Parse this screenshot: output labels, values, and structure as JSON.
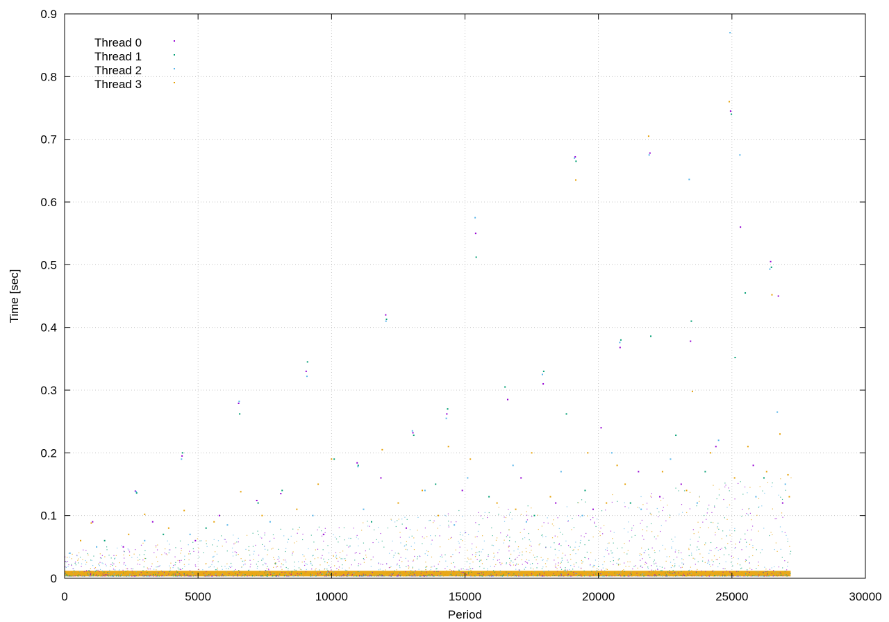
{
  "chart_data": {
    "type": "scatter",
    "xlabel": "Period",
    "ylabel": "Time [sec]",
    "xlim": [
      0,
      30000
    ],
    "ylim": [
      0,
      0.9
    ],
    "xticks": [
      0,
      5000,
      10000,
      15000,
      20000,
      25000,
      30000
    ],
    "yticks": [
      0,
      0.1,
      0.2,
      0.3,
      0.4,
      0.5,
      0.6,
      0.7,
      0.8,
      0.9
    ],
    "xtick_labels": [
      "0",
      "5000",
      "10000",
      "15000",
      "20000",
      "25000",
      "30000"
    ],
    "ytick_labels": [
      "0",
      "0.1",
      "0.2",
      "0.3",
      "0.4",
      "0.5",
      "0.6",
      "0.7",
      "0.8",
      "0.9"
    ],
    "grid": true,
    "legend": "top-left",
    "series": [
      {
        "name": "Thread 0",
        "color": "#9400d3",
        "points": [
          [
            2650,
            0.139
          ],
          [
            4400,
            0.195
          ],
          [
            6520,
            0.279
          ],
          [
            9050,
            0.33
          ],
          [
            10960,
            0.184
          ],
          [
            12030,
            0.42
          ],
          [
            13050,
            0.232
          ],
          [
            14320,
            0.262
          ],
          [
            15400,
            0.55
          ],
          [
            17930,
            0.31
          ],
          [
            19130,
            0.672
          ],
          [
            20810,
            0.368
          ],
          [
            21930,
            0.678
          ],
          [
            23450,
            0.378
          ],
          [
            24950,
            0.745
          ],
          [
            25320,
            0.56
          ],
          [
            26450,
            0.505
          ],
          [
            26740,
            0.45
          ],
          [
            24400,
            0.21
          ],
          [
            22300,
            0.13
          ],
          [
            21500,
            0.17
          ],
          [
            20100,
            0.24
          ],
          [
            18400,
            0.12
          ],
          [
            16600,
            0.285
          ],
          [
            8100,
            0.135
          ],
          [
            7200,
            0.124
          ],
          [
            11850,
            0.16
          ],
          [
            3300,
            0.09
          ],
          [
            1050,
            0.09
          ],
          [
            5800,
            0.1
          ],
          [
            14900,
            0.14
          ],
          [
            17100,
            0.16
          ],
          [
            19800,
            0.11
          ],
          [
            23100,
            0.15
          ],
          [
            25800,
            0.18
          ],
          [
            26900,
            0.12
          ],
          [
            12800,
            0.08
          ],
          [
            9700,
            0.07
          ],
          [
            4900,
            0.06
          ],
          [
            2200,
            0.05
          ]
        ]
      },
      {
        "name": "Thread 1",
        "color": "#009e73",
        "points": [
          [
            2700,
            0.136
          ],
          [
            4420,
            0.2
          ],
          [
            6560,
            0.262
          ],
          [
            9100,
            0.345
          ],
          [
            11000,
            0.18
          ],
          [
            12060,
            0.413
          ],
          [
            13080,
            0.228
          ],
          [
            14350,
            0.27
          ],
          [
            15420,
            0.512
          ],
          [
            17950,
            0.33
          ],
          [
            19160,
            0.665
          ],
          [
            20840,
            0.38
          ],
          [
            21960,
            0.386
          ],
          [
            23480,
            0.41
          ],
          [
            24980,
            0.74
          ],
          [
            25120,
            0.352
          ],
          [
            26480,
            0.496
          ],
          [
            25500,
            0.455
          ],
          [
            22900,
            0.228
          ],
          [
            18800,
            0.262
          ],
          [
            16500,
            0.305
          ],
          [
            7250,
            0.12
          ],
          [
            8150,
            0.14
          ],
          [
            10100,
            0.19
          ],
          [
            13900,
            0.15
          ],
          [
            15900,
            0.13
          ],
          [
            19500,
            0.14
          ],
          [
            21200,
            0.12
          ],
          [
            24000,
            0.17
          ],
          [
            26200,
            0.16
          ],
          [
            3700,
            0.07
          ],
          [
            5300,
            0.08
          ],
          [
            1500,
            0.06
          ],
          [
            11500,
            0.09
          ],
          [
            17600,
            0.1
          ]
        ]
      },
      {
        "name": "Thread 2",
        "color": "#56b4e9",
        "points": [
          [
            2680,
            0.138
          ],
          [
            4380,
            0.19
          ],
          [
            6540,
            0.282
          ],
          [
            9080,
            0.322
          ],
          [
            10990,
            0.178
          ],
          [
            12040,
            0.41
          ],
          [
            13030,
            0.235
          ],
          [
            14300,
            0.255
          ],
          [
            15380,
            0.575
          ],
          [
            17900,
            0.325
          ],
          [
            19100,
            0.67
          ],
          [
            20800,
            0.376
          ],
          [
            21900,
            0.675
          ],
          [
            23400,
            0.636
          ],
          [
            24930,
            0.87
          ],
          [
            25300,
            0.675
          ],
          [
            26420,
            0.493
          ],
          [
            26700,
            0.265
          ],
          [
            24500,
            0.22
          ],
          [
            22700,
            0.19
          ],
          [
            20500,
            0.2
          ],
          [
            18600,
            0.17
          ],
          [
            16800,
            0.18
          ],
          [
            15100,
            0.16
          ],
          [
            13500,
            0.14
          ],
          [
            11200,
            0.11
          ],
          [
            9300,
            0.1
          ],
          [
            7700,
            0.09
          ],
          [
            6100,
            0.085
          ],
          [
            4700,
            0.07
          ],
          [
            3000,
            0.06
          ],
          [
            1200,
            0.05
          ],
          [
            200,
            0.04
          ],
          [
            27000,
            0.15
          ],
          [
            25900,
            0.13
          ],
          [
            23700,
            0.12
          ],
          [
            21600,
            0.11
          ],
          [
            19400,
            0.1
          ],
          [
            17300,
            0.09
          ],
          [
            14600,
            0.085
          ]
        ]
      },
      {
        "name": "Thread 3",
        "color": "#e69f00",
        "points": [
          [
            1000,
            0.088
          ],
          [
            3000,
            0.102
          ],
          [
            4480,
            0.108
          ],
          [
            6600,
            0.138
          ],
          [
            9500,
            0.15
          ],
          [
            10000,
            0.19
          ],
          [
            11900,
            0.205
          ],
          [
            14380,
            0.21
          ],
          [
            15200,
            0.19
          ],
          [
            17500,
            0.2
          ],
          [
            19150,
            0.635
          ],
          [
            19600,
            0.2
          ],
          [
            20700,
            0.18
          ],
          [
            21880,
            0.705
          ],
          [
            23520,
            0.298
          ],
          [
            24900,
            0.76
          ],
          [
            26500,
            0.452
          ],
          [
            26800,
            0.23
          ],
          [
            27100,
            0.165
          ],
          [
            25600,
            0.21
          ],
          [
            24200,
            0.2
          ],
          [
            22400,
            0.17
          ],
          [
            21000,
            0.15
          ],
          [
            18200,
            0.13
          ],
          [
            16200,
            0.12
          ],
          [
            13400,
            0.14
          ],
          [
            12500,
            0.12
          ],
          [
            8700,
            0.11
          ],
          [
            7400,
            0.1
          ],
          [
            5600,
            0.09
          ],
          [
            3900,
            0.08
          ],
          [
            2400,
            0.07
          ],
          [
            600,
            0.06
          ],
          [
            14000,
            0.1
          ],
          [
            16900,
            0.11
          ],
          [
            20300,
            0.12
          ],
          [
            23300,
            0.14
          ],
          [
            25100,
            0.16
          ],
          [
            26300,
            0.17
          ],
          [
            27150,
            0.13
          ]
        ]
      }
    ]
  }
}
